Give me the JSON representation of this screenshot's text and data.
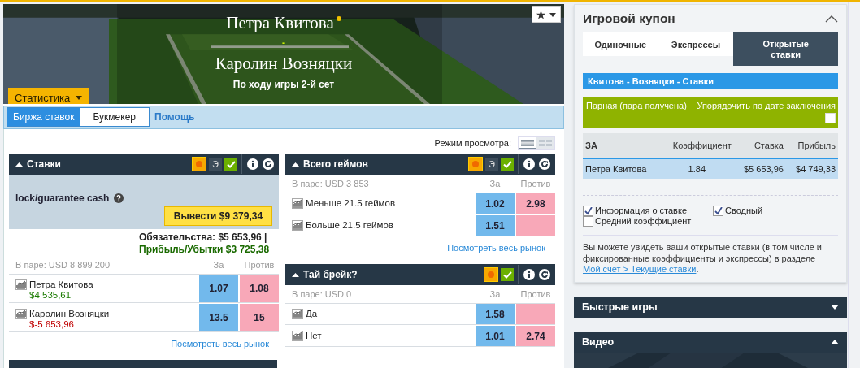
{
  "event": {
    "player_1": "Петра Квитова",
    "separator": "-",
    "player_2": "Каролин Возняцки",
    "status": "По ходу игры 2-й сет",
    "live": true,
    "stats_button": "Статистика",
    "favorite": false
  },
  "nav": {
    "tabs": [
      {
        "label": "Биржа ставок",
        "selected": true
      },
      {
        "label": "Букмекер",
        "selected": false
      }
    ],
    "help_link": "Помощь"
  },
  "view_mode": {
    "label": "Режим просмотра:",
    "options": [
      {
        "kind": "list",
        "selected": true
      },
      {
        "kind": "grid",
        "selected": false
      }
    ]
  },
  "market_columns": [
    {
      "markets": [
        {
          "title": "Ставки",
          "expanded": true,
          "e_label": "Э",
          "cashout": {
            "label": "lock/guarantee cash",
            "button": "Вывести $9 379,34"
          },
          "liability": "Обязательства: $5 653,96 |",
          "profit": "Прибыль/Убытки $3 725,38",
          "matched": "В паре: USD 8 899 200",
          "col_back": "За",
          "col_lay": "Против",
          "runners": [
            {
              "name": "Петра Квитова",
              "pnl": "$4 535,61",
              "loss": false,
              "back": "1.07",
              "lay": "1.08"
            },
            {
              "name": "Каролин Возняцки",
              "pnl": "$-5 653,96",
              "loss": true,
              "back": "13.5",
              "lay": "15"
            }
          ],
          "link": "Посмотреть весь рынок"
        }
      ]
    },
    {
      "markets": [
        {
          "title": "Всего геймов",
          "expanded": true,
          "e_label": "Э",
          "matched": "В паре: USD 3 853",
          "col_back": "За",
          "col_lay": "Против",
          "runners": [
            {
              "name": "Меньше 21.5 геймов",
              "back": "1.02",
              "lay": "2.98"
            },
            {
              "name": "Больше 21.5 геймов",
              "back": "1.51"
            }
          ],
          "link": "Посмотреть весь рынок"
        },
        {
          "title": "Тай брейк?",
          "expanded": true,
          "matched": "В паре: USD 0",
          "col_back": "За",
          "col_lay": "Против",
          "runners": [
            {
              "name": "Да",
              "back": "1.58"
            },
            {
              "name": "Нет",
              "back": "1.01",
              "lay": "2.74"
            }
          ]
        }
      ]
    }
  ],
  "coupon": {
    "title": "Игровой купон",
    "expanded": true,
    "tabs": [
      {
        "label": "Одиночные",
        "selected": false
      },
      {
        "label": "Экспрессы",
        "selected": false
      },
      {
        "label": "Открытые ставки",
        "selected": true
      }
    ],
    "market": "Квитова - Возняцки - Ставки",
    "filter": {
      "status": "Парная (пара получена)",
      "sort_label": "Упорядочить по дате заключения",
      "sort_checked": false
    },
    "columns": [
      "ЗА",
      "Коэффициент",
      "Ставка",
      "Прибыль"
    ],
    "rows": [
      {
        "cells": [
          "Петра Квитова",
          "1.84",
          "$5 653,96",
          "$4 749,33"
        ]
      }
    ],
    "options": [
      {
        "label": "Информация о ставке",
        "checked": true
      },
      {
        "label": "Сводный",
        "checked": true
      },
      {
        "label": "Средний коэффициент",
        "checked": false
      }
    ],
    "note": "Вы можете увидеть ваши открытые ставки (в том числе и фиксированные коэффициенты и экспрессы) в разделе ",
    "note_link": "Мой счет > Текущие ставки",
    "note_end": "."
  },
  "panels": [
    {
      "title": "Быстрые игры",
      "expanded": false
    },
    {
      "title": "Видео",
      "expanded": true
    }
  ]
}
